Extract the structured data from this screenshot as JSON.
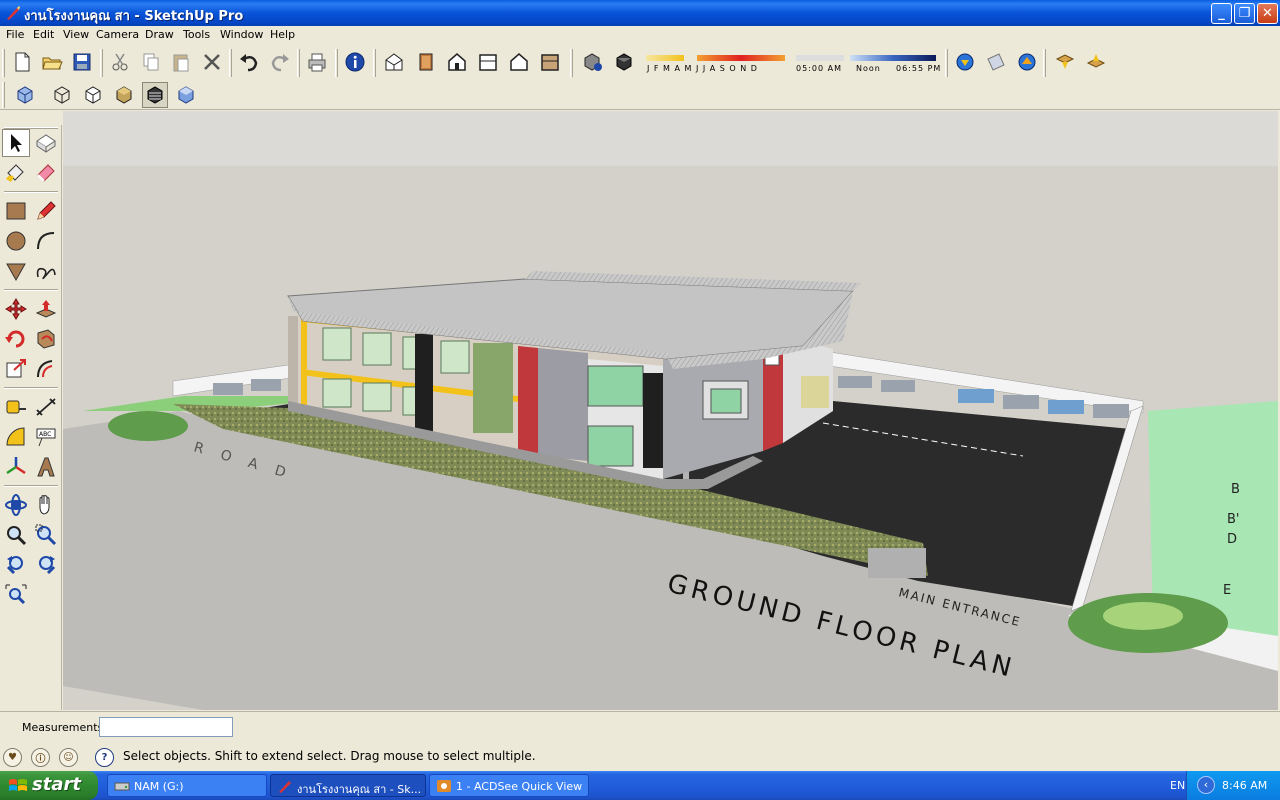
{
  "window": {
    "title": "งานโรงงานคุณ สา - SketchUp Pro",
    "min_label": "_",
    "max_label": "❐",
    "close_label": "✕"
  },
  "menu": [
    "File",
    "Edit",
    "View",
    "Camera",
    "Draw",
    "Tools",
    "Window",
    "Help"
  ],
  "shadow": {
    "months_label": "J F M A M J J A S O N D",
    "time_start": "05:00 AM",
    "time_mid": "Noon",
    "time_end": "06:55 PM"
  },
  "scene_text": {
    "road": "ROAD",
    "plan_title": "GROUND FLOOR PLAN",
    "main_entrance": "MAIN ENTRANCE",
    "grid_b": "B",
    "grid_b2": "B'",
    "grid_d": "D",
    "grid_e": "E"
  },
  "measurements": {
    "label": "Measurements",
    "value": ""
  },
  "status": {
    "text": "Select objects. Shift to extend select. Drag mouse to select multiple."
  },
  "taskbar": {
    "start": "start",
    "tasks": [
      {
        "label": "NAM (G:)"
      },
      {
        "label": "งานโรงงานคุณ สา - Sk..."
      },
      {
        "label": "1 - ACDSee Quick View"
      }
    ],
    "lang": "EN",
    "clock": "8:46 AM"
  },
  "colors": {
    "title_bar": "#0a5fe0",
    "sky": "#d3d1c9",
    "ground": "#e6e5e0",
    "asphalt": "#2b2b2b",
    "accent_yellow": "#f2c21b",
    "accent_red": "#c0383c",
    "glass": "#8fd3a4"
  }
}
